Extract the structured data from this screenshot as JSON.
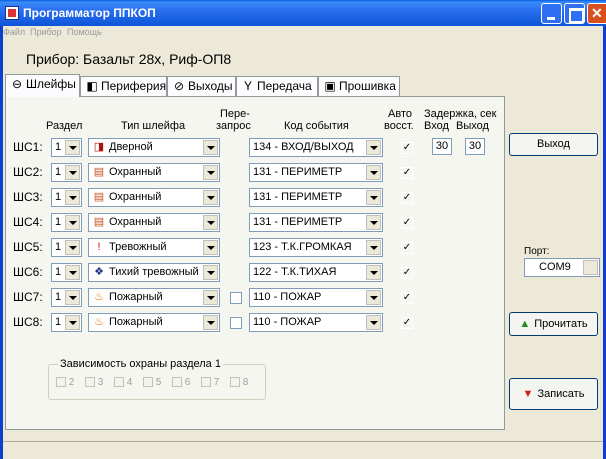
{
  "window": {
    "title": "Программатор ППКОП"
  },
  "menu": [
    "Файл",
    "Прибор",
    "Помощь"
  ],
  "device": "Прибор: Базальт 28х, Риф-ОП8",
  "tabs": [
    {
      "label": "Шлейфы",
      "icon": "loop-icon",
      "glyph": "⊖"
    },
    {
      "label": "Периферия",
      "icon": "speaker-icon",
      "glyph": "◧"
    },
    {
      "label": "Выходы",
      "icon": "outputs-icon",
      "glyph": "⊘"
    },
    {
      "label": "Передача",
      "icon": "antenna-icon",
      "glyph": "Y"
    },
    {
      "label": "Прошивка",
      "icon": "chip-icon",
      "glyph": "▣"
    }
  ],
  "headers": {
    "section": "Раздел",
    "loop_type": "Тип шлейфа",
    "requery_1": "Пере-",
    "requery_2": "запрос",
    "event_code": "Код события",
    "auto_1": "Авто",
    "auto_2": "восст.",
    "delay": "Задержка, сек",
    "delay_in": "Вход",
    "delay_out": "Выход"
  },
  "rows": [
    {
      "label": "ШС1:",
      "section": "1",
      "type": "Дверной",
      "type_icon": "door-icon",
      "glyph": "◨",
      "glyph_color": "#b01010",
      "requery": null,
      "event": "134 - ВХОД/ВЫХОД",
      "auto": true,
      "delay_in": "30",
      "delay_out": "30"
    },
    {
      "label": "ШС2:",
      "section": "1",
      "type": "Охранный",
      "type_icon": "wall-icon",
      "glyph": "▤",
      "glyph_color": "#c8501a",
      "requery": null,
      "event": "131 - ПЕРИМЕТР",
      "auto": true
    },
    {
      "label": "ШС3:",
      "section": "1",
      "type": "Охранный",
      "type_icon": "wall-icon",
      "glyph": "▤",
      "glyph_color": "#c8501a",
      "requery": null,
      "event": "131 - ПЕРИМЕТР",
      "auto": true
    },
    {
      "label": "ШС4:",
      "section": "1",
      "type": "Охранный",
      "type_icon": "wall-icon",
      "glyph": "▤",
      "glyph_color": "#c8501a",
      "requery": null,
      "event": "131 - ПЕРИМЕТР",
      "auto": true
    },
    {
      "label": "ШС5:",
      "section": "1",
      "type": "Тревожный",
      "type_icon": "exclamation-icon",
      "glyph": "!",
      "glyph_color": "#e01010",
      "requery": null,
      "event": "123 - Т.К.ГРОМКАЯ",
      "auto": true
    },
    {
      "label": "ШС6:",
      "section": "1",
      "type": "Тихий тревожный",
      "type_icon": "gear-alarm-icon",
      "glyph": "❖",
      "glyph_color": "#203080",
      "requery": null,
      "event": "122 - Т.К.ТИХАЯ",
      "auto": true
    },
    {
      "label": "ШС7:",
      "section": "1",
      "type": "Пожарный",
      "type_icon": "fire-icon",
      "glyph": "♨",
      "glyph_color": "#e07010",
      "requery": false,
      "event": "110 - ПОЖАР",
      "auto": true
    },
    {
      "label": "ШС8:",
      "section": "1",
      "type": "Пожарный",
      "type_icon": "fire-icon",
      "glyph": "♨",
      "glyph_color": "#e07010",
      "requery": false,
      "event": "110 - ПОЖАР",
      "auto": true
    }
  ],
  "dependency": {
    "title": "Зависимость охраны раздела 1",
    "items": [
      "2",
      "3",
      "4",
      "5",
      "6",
      "7",
      "8"
    ]
  },
  "buttons": {
    "exit": "Выход",
    "read": "Прочитать",
    "write": "Записать"
  },
  "port": {
    "label": "Порт:",
    "value": "COM9"
  },
  "colors": {
    "titlebar": "#0a5ce6",
    "read_icon": "#1f8a1f",
    "write_icon": "#d02020"
  }
}
